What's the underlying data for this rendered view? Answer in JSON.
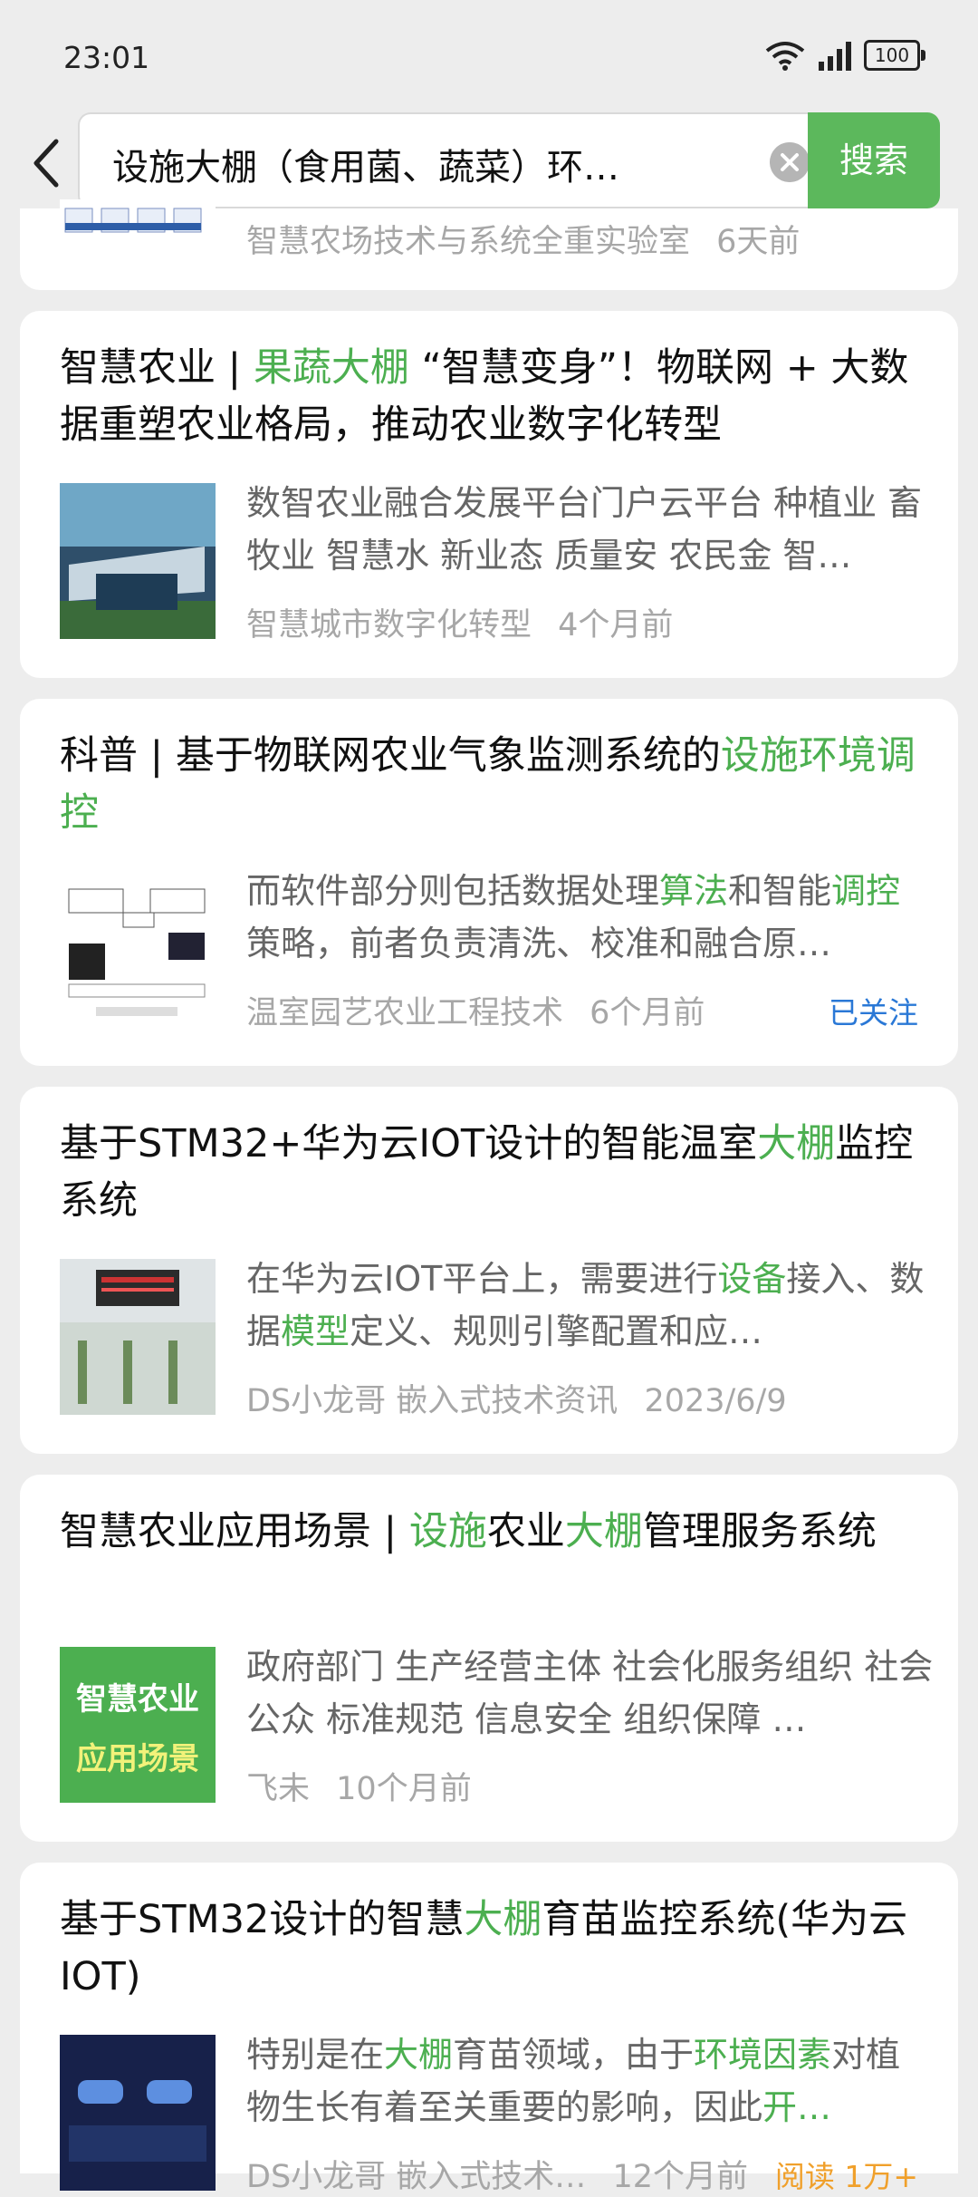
{
  "status": {
    "time": "23:01",
    "battery": "100"
  },
  "search": {
    "query": "设施大棚（食用菌、蔬菜）环…",
    "button": "搜索"
  },
  "partial_card": {
    "meta": "智慧农场技术与系统全重实验室",
    "time": "6天前"
  },
  "results": [
    {
      "title_parts": [
        "智慧农业 | ",
        "果蔬大棚",
        " “智慧变身”！物联网 + 大数据重塑农业格局，推动农业数字化转型"
      ],
      "desc_parts": [
        "数智农业融合发展平台门户云平台 种植业 畜牧业 智慧水 新业态 质量安 农民金 智…"
      ],
      "source": "智慧城市数字化转型",
      "time": "4个月前"
    },
    {
      "title_parts": [
        "科普 | 基于物联网农业气象监测系统的",
        "设施环境调控"
      ],
      "desc_parts": [
        "而软件部分则包括数据处理",
        "算法",
        "和智能",
        "调控",
        "策略，前者负责清洗、校准和融合原…"
      ],
      "source": "温室园艺农业工程技术",
      "time": "6个月前",
      "follow": "已关注"
    },
    {
      "title_parts": [
        "基于STM32+华为云IOT设计的智能温室",
        "大棚",
        "监控系统"
      ],
      "desc_parts": [
        "在华为云IOT平台上，需要进行",
        "设备",
        "接入、数据",
        "模型",
        "定义、规则引擎配置和应…"
      ],
      "source": "DS小龙哥 嵌入式技术资讯",
      "time": "2023/6/9"
    },
    {
      "title_parts": [
        "智慧农业应用场景 | ",
        "设施",
        "农业",
        "大棚",
        "管理服务系统"
      ],
      "desc_parts": [
        "政府部门 生产经营主体 社会化服务组织 社会公众 标准规范 信息安全 组织保障 …"
      ],
      "source": "飞未",
      "time": "10个月前",
      "thumb_text_1": "智慧农业",
      "thumb_text_2": "应用场景"
    },
    {
      "title_parts": [
        "基于STM32设计的智慧",
        "大棚",
        "育苗监控系统(华为云IOT)"
      ],
      "desc_parts": [
        "特别是在",
        "大棚",
        "育苗领域，由于",
        "环境因素",
        "对植物生长有着至关重要的影响，因此",
        "开…"
      ],
      "source": "DS小龙哥 嵌入式技术…",
      "time": "12个月前",
      "reads": "阅读 1万+"
    }
  ],
  "colors": {
    "accent": "#5cb85c",
    "highlight": "#4caf50",
    "follow": "#2a78d6",
    "reads": "#f0a02b"
  }
}
